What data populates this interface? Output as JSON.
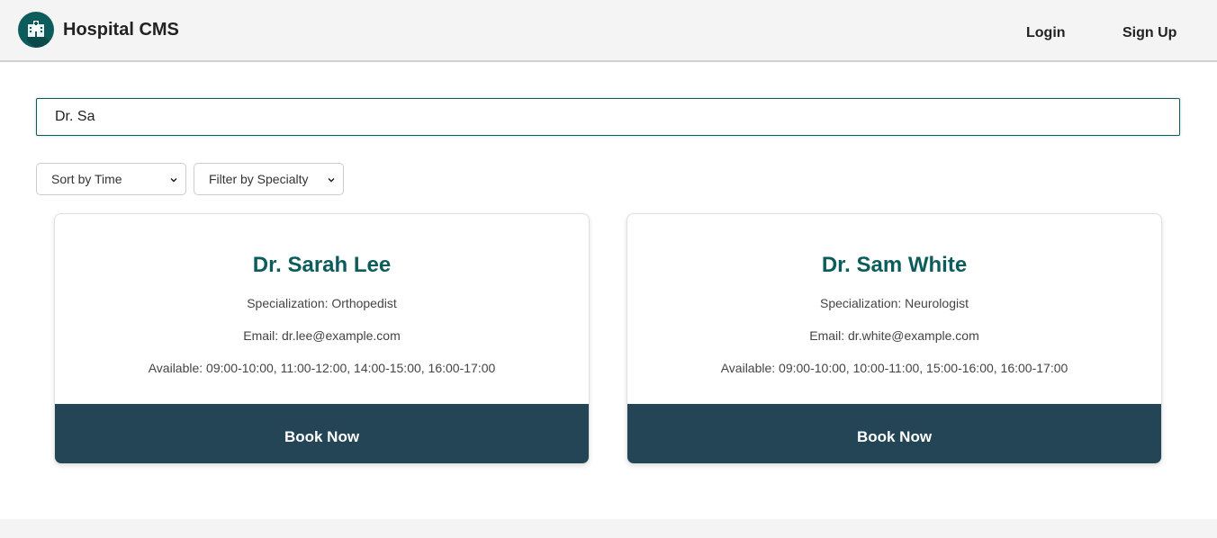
{
  "header": {
    "brand": "Hospital CMS",
    "logo_icon": "hospital-icon",
    "nav": {
      "login": "Login",
      "signup": "Sign Up"
    }
  },
  "search": {
    "value": "Dr. Sa"
  },
  "filters": {
    "sort": {
      "selected": "Sort by Time"
    },
    "specialty": {
      "selected": "Filter by Specialty"
    }
  },
  "doctors": [
    {
      "name": "Dr. Sarah Lee",
      "specialization": "Specialization: Orthopedist",
      "email": "Email: dr.lee@example.com",
      "available": "Available: 09:00-10:00, 11:00-12:00, 14:00-15:00, 16:00-17:00",
      "button": "Book Now"
    },
    {
      "name": "Dr. Sam White",
      "specialization": "Specialization: Neurologist",
      "email": "Email: dr.white@example.com",
      "available": "Available: 09:00-10:00, 10:00-11:00, 15:00-16:00, 16:00-17:00",
      "button": "Book Now"
    }
  ],
  "colors": {
    "brand_teal": "#0d5c5c",
    "button_navy": "#234556",
    "header_bg": "#f4f4f4"
  }
}
